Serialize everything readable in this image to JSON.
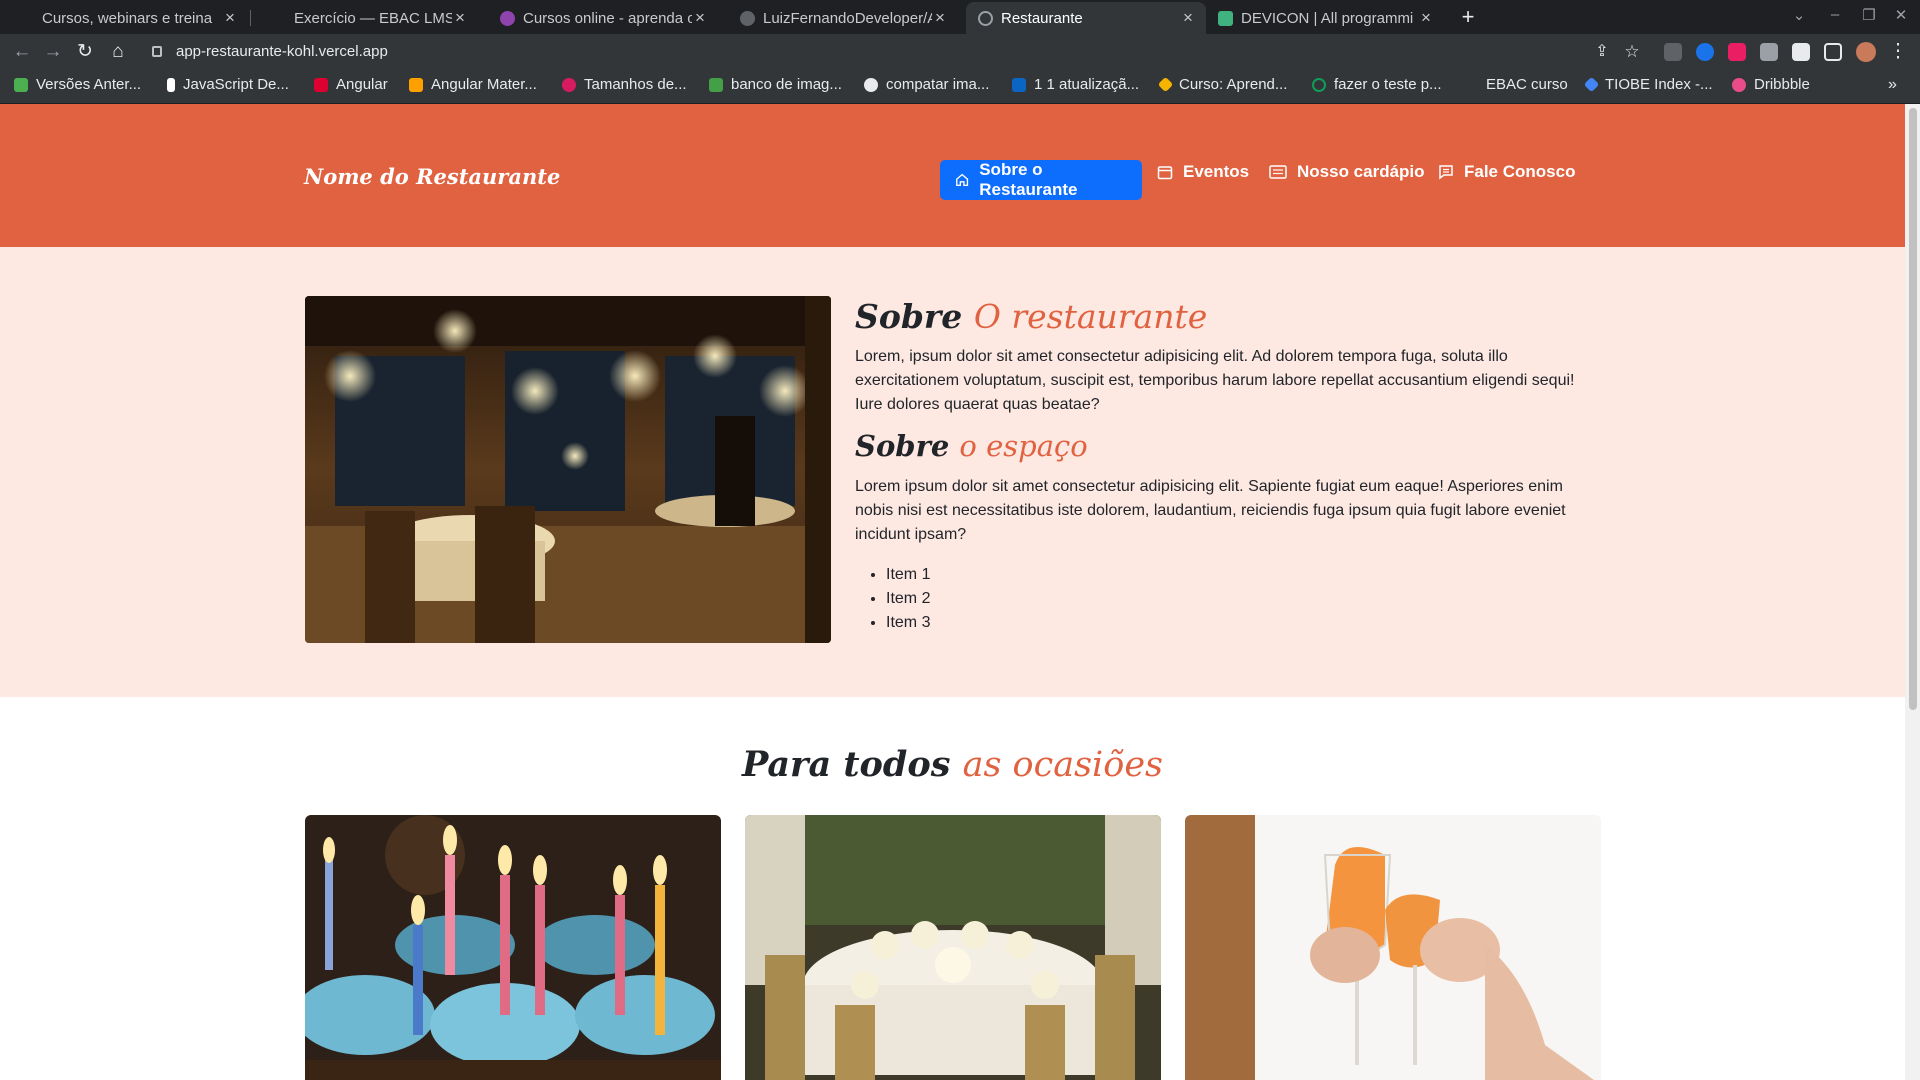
{
  "browser": {
    "tabs": [
      {
        "title": "Cursos, webinars e treina",
        "active": false
      },
      {
        "title": "Exercício — EBAC LMS",
        "active": false
      },
      {
        "title": "Cursos online - aprenda o",
        "active": false
      },
      {
        "title": "LuizFernandoDeveloper/A",
        "active": false
      },
      {
        "title": "Restaurante",
        "active": true
      },
      {
        "title": "DEVICON | All programmi",
        "active": false
      }
    ],
    "close_glyph": "×",
    "new_tab_glyph": "+",
    "url": "app-restaurante-kohl.vercel.app",
    "bookmarks": [
      {
        "label": "Versões Anter...",
        "color": "#4caf50"
      },
      {
        "label": "JavaScript De...",
        "color": "#ffffff"
      },
      {
        "label": "Angular",
        "color": "#dd0031"
      },
      {
        "label": "Angular Mater...",
        "color": "#ffa000"
      },
      {
        "label": "Tamanhos de...",
        "color": "#d81b60"
      },
      {
        "label": "banco de imag...",
        "color": "#43a047"
      },
      {
        "label": "compatar ima...",
        "color": "#e8eaed"
      },
      {
        "label": "1 1 atualizaçã...",
        "color": "#0a66c2"
      },
      {
        "label": "Curso: Aprend...",
        "color": "#f4b400"
      },
      {
        "label": "fazer o teste p...",
        "color": "#0f9d58"
      },
      {
        "label": "EBAC curso",
        "color": ""
      },
      {
        "label": "TIOBE Index -...",
        "color": "#4285f4"
      },
      {
        "label": "Dribbble",
        "color": "#ea4c89"
      }
    ]
  },
  "site": {
    "brand": "Nome do Restaurante",
    "nav": [
      {
        "label": "Sobre o Restaurante",
        "icon": "home-icon",
        "active": true
      },
      {
        "label": "Eventos",
        "icon": "calendar-icon",
        "active": false
      },
      {
        "label": "Nosso cardápio",
        "icon": "menu-card-icon",
        "active": false
      },
      {
        "label": "Fale Conosco",
        "icon": "chat-icon",
        "active": false
      }
    ],
    "about": {
      "title1_plain": "Sobre",
      "title1_accent": "O restaurante",
      "text1": "Lorem, ipsum dolor sit amet consectetur adipisicing elit. Ad dolorem tempora fuga, soluta illo exercitationem voluptatum, suscipit est, temporibus harum labore repellat accusantium eligendi sequi! Iure dolores quaerat quas beatae?",
      "title2_plain": "Sobre",
      "title2_accent": "o espaço",
      "text2": "Lorem ipsum dolor sit amet consectetur adipisicing elit. Sapiente fugiat eum eaque! Asperiores enim nobis nisi est necessitatibus iste dolorem, laudantium, reiciendis fuga ipsum quia fugit labore eveniet incidunt ipsam?",
      "items": [
        "Item 1",
        "Item 2",
        "Item 3"
      ]
    },
    "occasions": {
      "title_plain": "Para todos",
      "title_accent": "as ocasiões"
    },
    "colors": {
      "header": "#e06240",
      "accent": "#e06240",
      "about_bg": "#fde8e2",
      "active_nav": "#0d6efd"
    }
  }
}
